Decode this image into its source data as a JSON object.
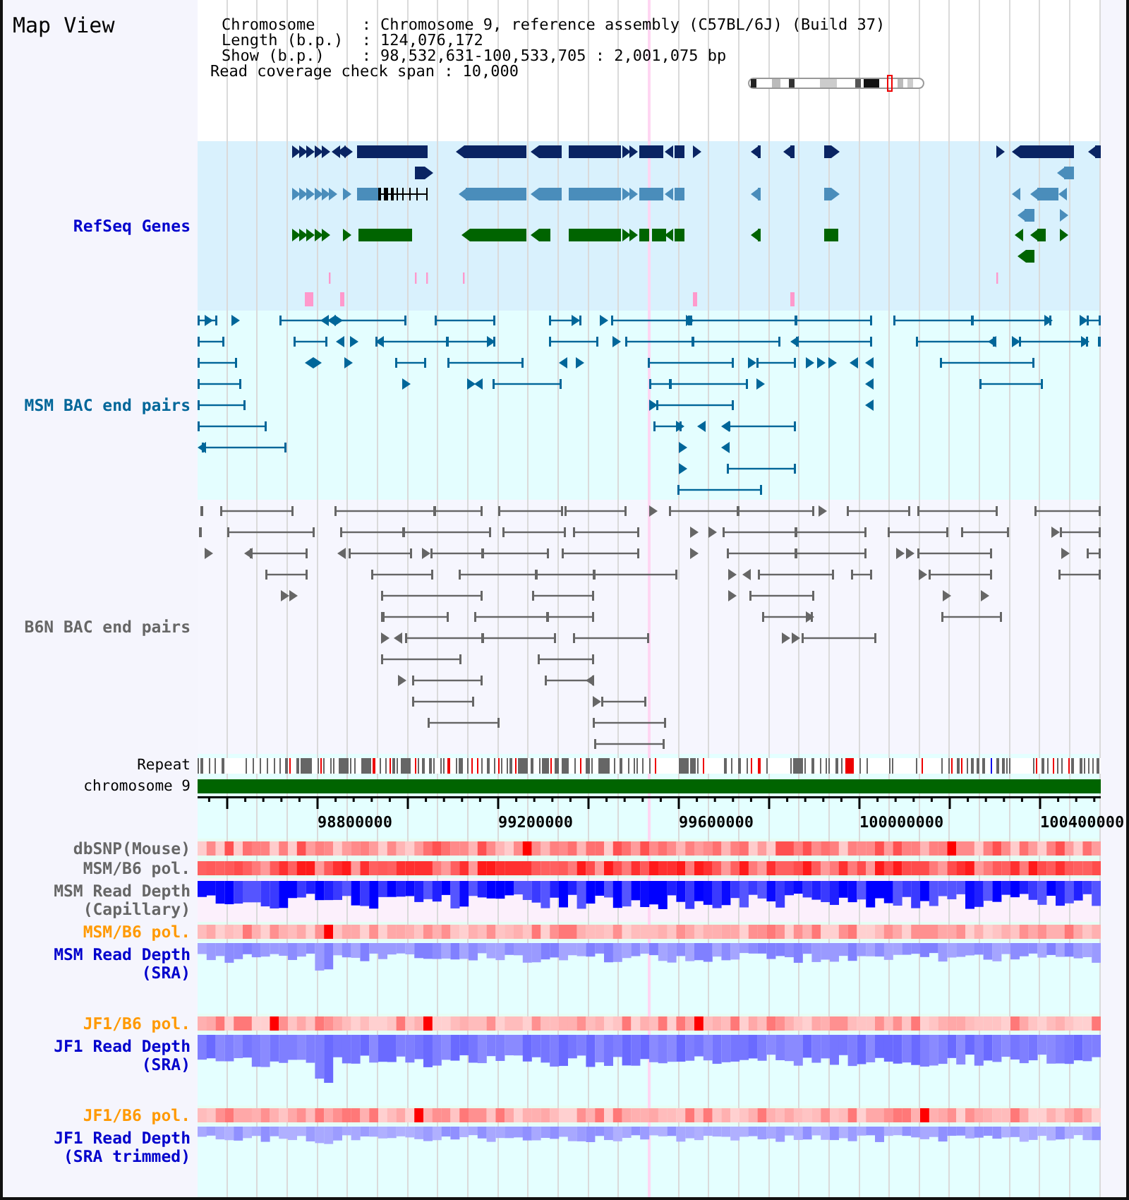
{
  "title": "Map View",
  "info": [
    {
      "label": "Chromosome",
      "sep": ":",
      "value": "Chromosome 9, reference assembly (C57BL/6J) (Build 37)"
    },
    {
      "label": "Length (b.p.)",
      "sep": ":",
      "value": "124,076,172"
    },
    {
      "label": "Show (b.p.)",
      "sep": ":",
      "value": "98,532,631-100,533,705 : 2,001,075 bp"
    }
  ],
  "coverage_span": {
    "label": "Read coverage check span",
    "sep": ":",
    "value": "10,000"
  },
  "feature_tracks": [
    {
      "kind": "genes",
      "label": "RefSeq Genes",
      "color": "#0000cc"
    },
    {
      "kind": "msm_bac_pairs",
      "label": "MSM BAC end pairs",
      "color": "#006699"
    },
    {
      "kind": "b6n_bac_pairs",
      "label": "B6N BAC end pairs",
      "color": "#666666"
    }
  ],
  "reference_tracks": [
    {
      "kind": "repeat",
      "label": "Repeat"
    },
    {
      "kind": "chromosome",
      "label": "chromosome 9"
    }
  ],
  "ruler": {
    "labels": [
      "98800000",
      "99200000",
      "99600000",
      "100000000",
      "100400000"
    ]
  },
  "data_tracks": [
    {
      "kind": "heatmap",
      "label": "dbSNP(Mouse)",
      "color": "#666666"
    },
    {
      "kind": "heatmap",
      "label": "MSM/B6 pol.",
      "color": "#666666"
    },
    {
      "kind": "depth_capillary",
      "label": "MSM Read Depth (Capillary)",
      "color": "#666666"
    },
    {
      "kind": "heatmap",
      "label": "MSM/B6 pol.",
      "color": "#ff9900"
    },
    {
      "kind": "depth_sra",
      "label": "MSM Read Depth (SRA)",
      "color": "#0000cc"
    },
    {
      "kind": "heatmap",
      "label": "JF1/B6 pol.",
      "color": "#ff9900"
    },
    {
      "kind": "depth_sra",
      "label": "JF1 Read Depth (SRA)",
      "color": "#0000cc"
    },
    {
      "kind": "heatmap",
      "label": "JF1/B6 pol.",
      "color": "#ff9900"
    },
    {
      "kind": "depth_sra",
      "label": "JF1 Read Depth (SRA trimmed)",
      "color": "#0000cc"
    }
  ]
}
